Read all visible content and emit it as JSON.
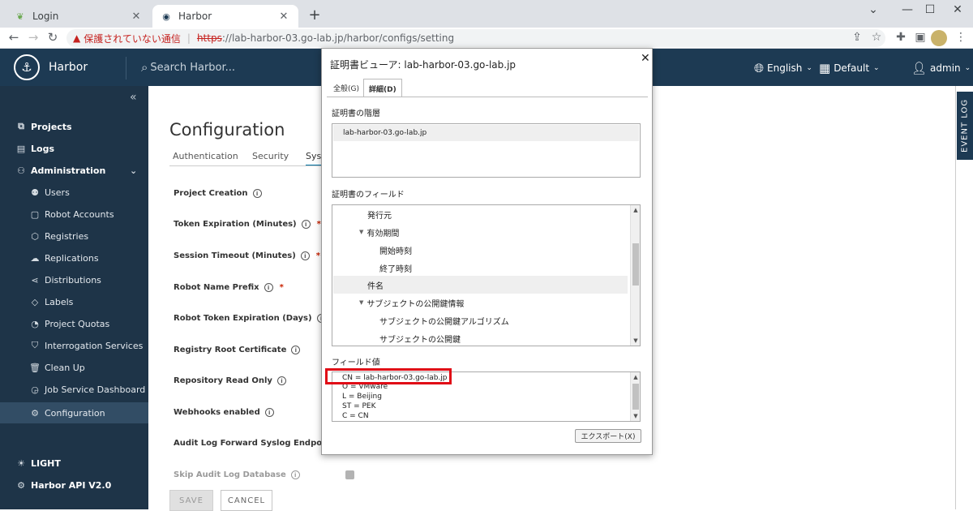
{
  "browser": {
    "tabs": [
      {
        "title": "Login",
        "active": false
      },
      {
        "title": "Harbor",
        "active": true
      }
    ],
    "new_tab": "+",
    "window_controls": [
      "⌄",
      "—",
      "☐",
      "✕"
    ],
    "address": {
      "warning": "保護されていない通信",
      "scheme": "https",
      "rest": "://lab-harbor-03.go-lab.jp/harbor/configs/setting"
    }
  },
  "header": {
    "brand": "Harbor",
    "search_placeholder": "Search Harbor...",
    "language": "English",
    "theme_scope": "Default",
    "user": "admin"
  },
  "sidebar": {
    "items": [
      {
        "label": "Projects",
        "icon": "projects-icon",
        "level": "top"
      },
      {
        "label": "Logs",
        "icon": "logs-icon",
        "level": "top"
      },
      {
        "label": "Administration",
        "icon": "administration-icon",
        "level": "top",
        "expanded": true
      },
      {
        "label": "Users",
        "icon": "users-icon",
        "level": "sub"
      },
      {
        "label": "Robot Accounts",
        "icon": "robot-icon",
        "level": "sub"
      },
      {
        "label": "Registries",
        "icon": "registries-icon",
        "level": "sub"
      },
      {
        "label": "Replications",
        "icon": "replications-icon",
        "level": "sub"
      },
      {
        "label": "Distributions",
        "icon": "distributions-icon",
        "level": "sub"
      },
      {
        "label": "Labels",
        "icon": "labels-icon",
        "level": "sub"
      },
      {
        "label": "Project Quotas",
        "icon": "quotas-icon",
        "level": "sub"
      },
      {
        "label": "Interrogation Services",
        "icon": "interrogation-icon",
        "level": "sub"
      },
      {
        "label": "Clean Up",
        "icon": "cleanup-icon",
        "level": "sub"
      },
      {
        "label": "Job Service Dashboard",
        "icon": "dashboard-icon",
        "level": "sub"
      },
      {
        "label": "Configuration",
        "icon": "gear-icon",
        "level": "sub",
        "active": true
      }
    ],
    "theme_toggle": "LIGHT",
    "api_link": "Harbor API V2.0"
  },
  "main": {
    "title": "Configuration",
    "tabs": [
      "Authentication",
      "Security",
      "Sys"
    ],
    "fields": [
      {
        "label": "Project Creation",
        "required": false
      },
      {
        "label": "Token Expiration (Minutes)",
        "required": true
      },
      {
        "label": "Session Timeout (Minutes)",
        "required": true
      },
      {
        "label": "Robot Name Prefix",
        "required": true
      },
      {
        "label": "Robot Token Expiration (Days)",
        "required": true
      },
      {
        "label": "Registry Root Certificate",
        "required": false
      },
      {
        "label": "Repository Read Only",
        "required": false
      },
      {
        "label": "Webhooks enabled",
        "required": false
      },
      {
        "label": "Audit Log Forward Syslog Endpoint",
        "required": false
      },
      {
        "label": "Skip Audit Log Database",
        "required": false
      }
    ],
    "save_label": "SAVE",
    "cancel_label": "CANCEL"
  },
  "event_log": "EVENT LOG",
  "dialog": {
    "title": "証明書ビューア: lab-harbor-03.go-lab.jp",
    "tabs": [
      "全般(G)",
      "詳細(D)"
    ],
    "hierarchy_label": "証明書の階層",
    "hierarchy_items": [
      "lab-harbor-03.go-lab.jp"
    ],
    "fields_label": "証明書のフィールド",
    "field_items": [
      {
        "text": "発行元",
        "indent": 2,
        "expander": false
      },
      {
        "text": "有効期間",
        "indent": 1,
        "expander": true
      },
      {
        "text": "開始時刻",
        "indent": 3,
        "expander": false
      },
      {
        "text": "終了時刻",
        "indent": 3,
        "expander": false
      },
      {
        "text": "件名",
        "indent": 2,
        "expander": false,
        "selected": true
      },
      {
        "text": "サブジェクトの公開鍵情報",
        "indent": 1,
        "expander": true
      },
      {
        "text": "サブジェクトの公開鍵アルゴリズム",
        "indent": 3,
        "expander": false
      },
      {
        "text": "サブジェクトの公開鍵",
        "indent": 3,
        "expander": false
      }
    ],
    "value_label": "フィールド値",
    "value_lines": [
      "CN = lab-harbor-03.go-lab.jp",
      "O = VMware",
      "L = Beijing",
      "ST = PEK",
      "C = CN"
    ],
    "export_label": "エクスポート(X)"
  }
}
